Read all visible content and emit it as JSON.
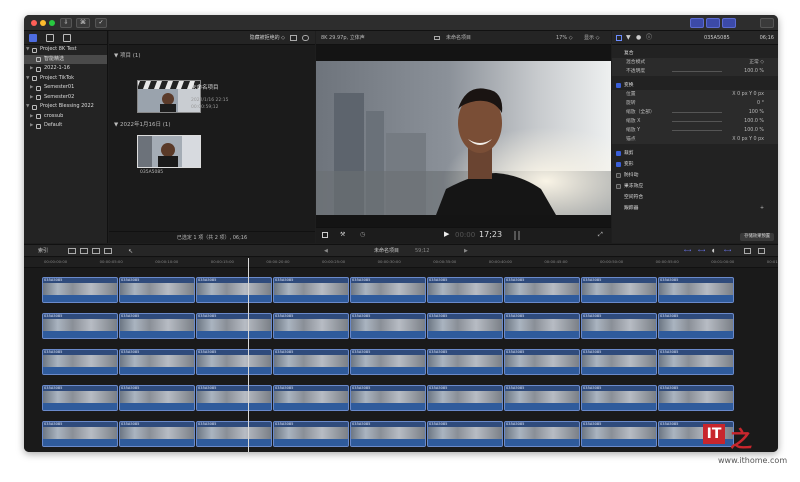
{
  "titlebar": {
    "key_label": "⌘",
    "check_label": "✓"
  },
  "library": {
    "items": [
      {
        "label": "Project 8K Test",
        "level": 0,
        "arrow": "▼",
        "selected": false
      },
      {
        "label": "智能精选",
        "level": 1,
        "arrow": "",
        "selected": true
      },
      {
        "label": "2022-1-16",
        "level": 1,
        "arrow": "▶",
        "selected": false
      },
      {
        "label": "Project TikTok",
        "level": 0,
        "arrow": "▼",
        "selected": false
      },
      {
        "label": "Semester01",
        "level": 1,
        "arrow": "▶",
        "selected": false
      },
      {
        "label": "Semester02",
        "level": 1,
        "arrow": "▶",
        "selected": false
      },
      {
        "label": "Project Blessing 2022",
        "level": 0,
        "arrow": "▼",
        "selected": false
      },
      {
        "label": "crossub",
        "level": 1,
        "arrow": "▶",
        "selected": false
      },
      {
        "label": "Default",
        "level": 1,
        "arrow": "▶",
        "selected": false
      }
    ]
  },
  "browser": {
    "filter_label": "隐藏被拒绝的 ◇",
    "projects_section": "项目",
    "projects_count": "(1)",
    "project_title": "未命名项目",
    "project_date": "2022/1/16  22:15",
    "project_duration": "00:00:59;12",
    "date_section": "2022年1月16日",
    "date_count": "(1)",
    "clip_name": "035A5085",
    "footer": "已选定 1 项（共 2 项）, 06;16"
  },
  "viewer": {
    "format": "8K 29.97p, 立体声",
    "project": "未命名项目",
    "zoom": "17% ◇",
    "display": "显示 ◇",
    "timecode_dim": "00:00",
    "timecode": "17;23"
  },
  "inspector": {
    "clip_name": "035A5085",
    "duration": "06;16",
    "rows": [
      {
        "label": "复合",
        "value": ""
      },
      {
        "label": "混合模式",
        "value": "正常 ◇"
      },
      {
        "label": "不透明度",
        "value": "100.0 %"
      },
      {
        "label": "变换",
        "value": ""
      },
      {
        "label": "位置",
        "value": "X  0 px   Y  0 px"
      },
      {
        "label": "旋转",
        "value": "0 °"
      },
      {
        "label": "缩放（全部）",
        "value": "100 %"
      },
      {
        "label": "缩放 X",
        "value": "100.0 %"
      },
      {
        "label": "缩放 Y",
        "value": "100.0 %"
      },
      {
        "label": "锚点",
        "value": "X  0 px   Y  0 px"
      },
      {
        "label": "裁剪",
        "value": ""
      },
      {
        "label": "变形",
        "value": ""
      },
      {
        "label": "防抖动",
        "value": ""
      },
      {
        "label": "果冻效应",
        "value": ""
      },
      {
        "label": "空间符合",
        "value": ""
      },
      {
        "label": "跟踪器",
        "value": "+"
      }
    ],
    "save_button": "存储效果预置"
  },
  "timeline": {
    "index_label": "索引",
    "project": "未命名项目",
    "duration": "59;12",
    "ruler": [
      "00:00:00:00",
      "00:00:05:00",
      "00:00:10:00",
      "00:00:15:00",
      "00:00:20:00",
      "00:00:25:00",
      "00:00:30:00",
      "00:00:35:00",
      "00:00:40:00",
      "00:00:45:00",
      "00:00:50:00",
      "00:00:55:00",
      "00:01:00:00",
      "00:01:05:00"
    ],
    "clip_label": "035A5085"
  },
  "watermark": {
    "logo": "IT",
    "site": "www.ithome.com"
  },
  "colors": {
    "accent": "#3c4aa8",
    "clip_blue": "#2f4b7c",
    "checkbox": "#3a5fd9"
  }
}
